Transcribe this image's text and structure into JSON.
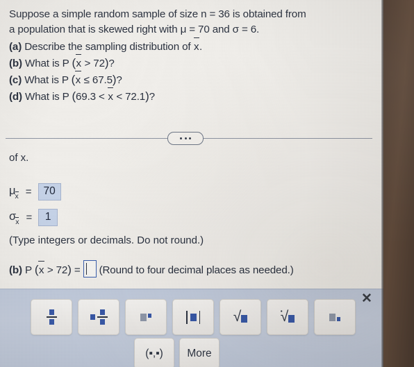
{
  "problem": {
    "line1": "Suppose a simple random sample of size n = 36 is obtained from",
    "line2": "a population that is skewed right with μ = 70 and σ = 6.",
    "part_a": {
      "tag": "(a)",
      "text_before": "Describe the sampling distribution of ",
      "var": "x",
      "text_after": "."
    },
    "part_b": {
      "tag": "(b)",
      "text_before": "What is P ",
      "open": "(",
      "var": "x",
      "expr": " > 72",
      "close": ")",
      "text_after": "?"
    },
    "part_c": {
      "tag": "(c)",
      "text_before": "What is P ",
      "open": "(",
      "var": "x",
      "expr": " ≤ 67.5",
      "close": ")",
      "text_after": "?"
    },
    "part_d": {
      "tag": "(d)",
      "text_before": "What is P ",
      "open": "(",
      "expr_before": "69.3 < ",
      "var": "x",
      "expr_after": " < 72.1",
      "close": ")",
      "text_after": "?"
    }
  },
  "divider": {
    "ellipsis_label": "more-options"
  },
  "answer_area": {
    "continued_text": "of x.",
    "mu": {
      "symbol": "μ",
      "sub": "x",
      "equals": "=",
      "value": "70"
    },
    "sigma": {
      "symbol": "σ",
      "sub": "x",
      "equals": "=",
      "value": "1"
    },
    "instruction": "(Type integers or decimals. Do not round.)",
    "part_b_row": {
      "tag": "(b)",
      "prefix": "P ",
      "open": "(",
      "var": "x",
      "expr": " > 72",
      "close": ")",
      "equals": "=",
      "input_value": "",
      "hint": "(Round to four decimal places as needed.)"
    }
  },
  "keypad": {
    "row1": [
      {
        "name": "fraction-button",
        "label": "fraction"
      },
      {
        "name": "mixed-number-button",
        "label": "mixed number"
      },
      {
        "name": "exponent-button",
        "label": "exponent"
      },
      {
        "name": "absolute-value-button",
        "label": "absolute value"
      },
      {
        "name": "square-root-button",
        "label": "square root"
      },
      {
        "name": "nth-root-button",
        "label": "nth root"
      },
      {
        "name": "subscript-button",
        "label": "subscript"
      }
    ],
    "row2": [
      {
        "name": "interval-button",
        "label": "(▪,▪)"
      },
      {
        "name": "more-button",
        "label": "More"
      }
    ],
    "close_label": "✕"
  },
  "colors": {
    "paper": "#f1efeb",
    "text": "#2b3240",
    "answer_highlight": "#c6d3e8",
    "keypad_bg": "#c3cddf",
    "accent_blue": "#3657a8",
    "bezel": "#4e3c30"
  }
}
